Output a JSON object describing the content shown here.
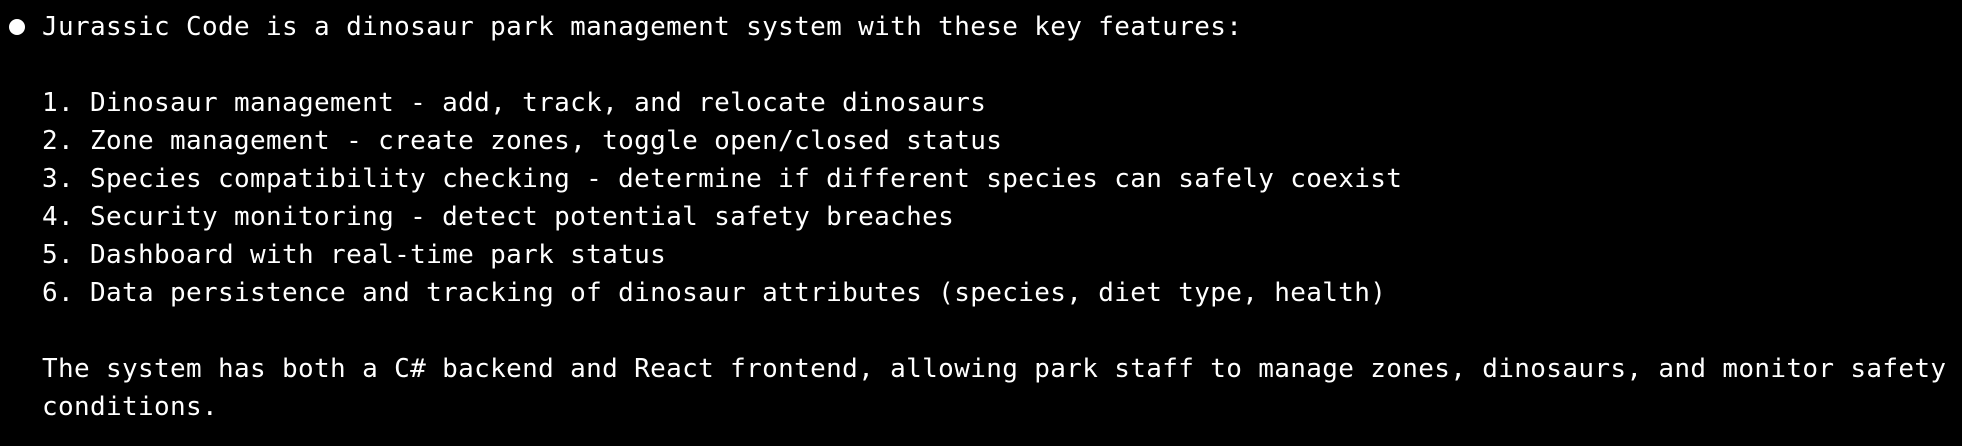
{
  "terminal": {
    "bullet_color": "#ffffff",
    "background_color": "#000000",
    "intro": "Jurassic Code is a dinosaur park management system with these key features:",
    "features": [
      "1. Dinosaur management - add, track, and relocate dinosaurs",
      "2. Zone management - create zones, toggle open/closed status",
      "3. Species compatibility checking - determine if different species can safely coexist",
      "4. Security monitoring - detect potential safety breaches",
      "5. Dashboard with real-time park status",
      "6. Data persistence and tracking of dinosaur attributes (species, diet type, health)"
    ],
    "summary_line1": "The system has both a C# backend and React frontend, allowing park staff to manage zones, dinosaurs, and monitor safety",
    "summary_line2": "conditions."
  }
}
